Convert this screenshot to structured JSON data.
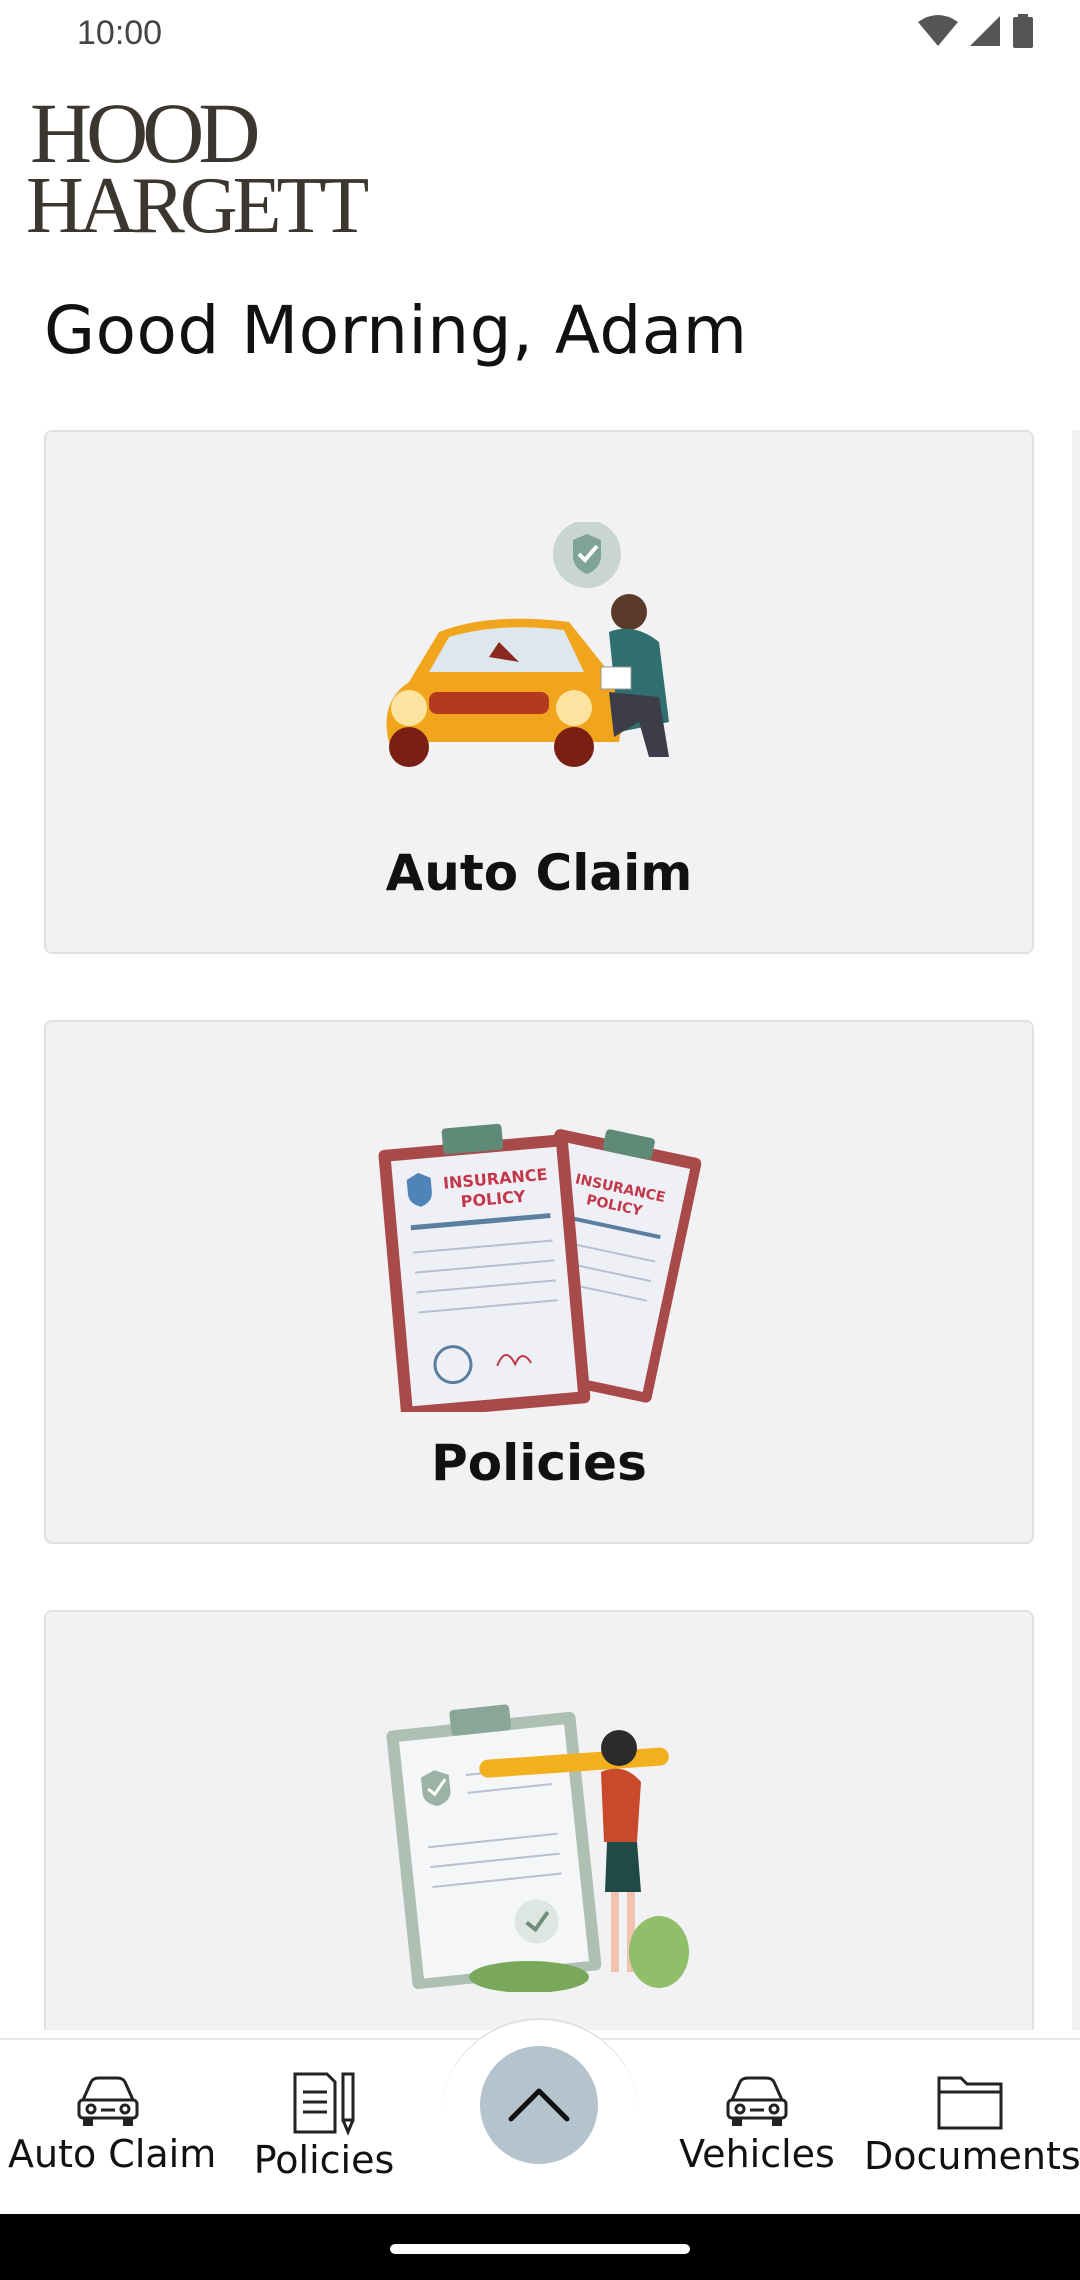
{
  "status": {
    "time": "10:00"
  },
  "logo": {
    "line1": "HOOD",
    "line2": "HARGETT"
  },
  "greeting": "Good Morning, Adam",
  "cards": [
    {
      "label": "Auto Claim",
      "illustration": "car-damage-inspection"
    },
    {
      "label": "Policies",
      "illustration": "insurance-policy-clipboards"
    },
    {
      "label": "",
      "illustration": "checklist-woman-pencil"
    }
  ],
  "nav": {
    "items": [
      {
        "label": "Auto Claim",
        "icon": "car-icon"
      },
      {
        "label": "Policies",
        "icon": "document-pencil-icon"
      },
      {
        "label": "Vehicles",
        "icon": "car-icon"
      },
      {
        "label": "Documents",
        "icon": "folder-icon"
      }
    ],
    "center_button_icon": "chevron-up-icon"
  },
  "colors": {
    "card_bg": "#f2f2f4",
    "fab_bg": "#b5c4cc",
    "logo": "#3b3630"
  }
}
